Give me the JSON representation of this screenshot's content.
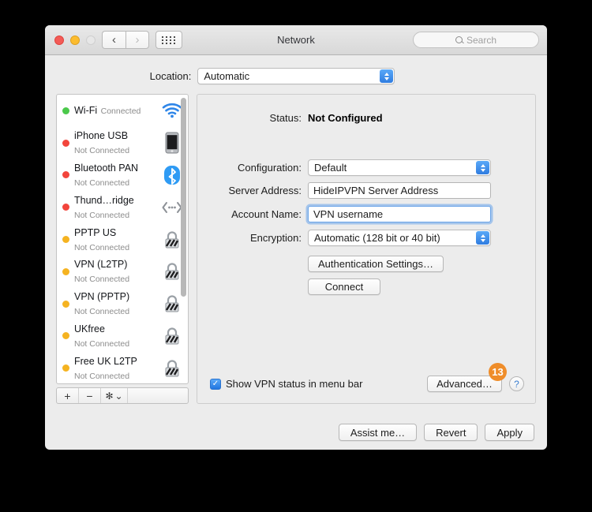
{
  "window": {
    "title": "Network",
    "search_placeholder": "Search",
    "traffic_lights": [
      "close",
      "minimize",
      "zoom"
    ],
    "nav_back_icon": "chevron-left-icon",
    "nav_forward_icon": "chevron-right-icon",
    "grid_icon": "show-all-icon",
    "search_icon": "search-icon"
  },
  "location": {
    "label": "Location:",
    "value": "Automatic"
  },
  "sidebar": {
    "services": [
      {
        "name": "Wi-Fi",
        "state": "Connected",
        "dot": "green",
        "icon": "wifi-icon"
      },
      {
        "name": "iPhone USB",
        "state": "Not Connected",
        "dot": "red",
        "icon": "iphone-icon"
      },
      {
        "name": "Bluetooth PAN",
        "state": "Not Connected",
        "dot": "red",
        "icon": "bluetooth-icon"
      },
      {
        "name": "Thund…ridge",
        "state": "Not Connected",
        "dot": "red",
        "icon": "thunderbolt-bridge-icon"
      },
      {
        "name": "PPTP US",
        "state": "Not Connected",
        "dot": "amber",
        "icon": "vpn-lock-icon"
      },
      {
        "name": "VPN (L2TP)",
        "state": "Not Connected",
        "dot": "amber",
        "icon": "vpn-lock-icon"
      },
      {
        "name": "VPN (PPTP)",
        "state": "Not Connected",
        "dot": "amber",
        "icon": "vpn-lock-icon"
      },
      {
        "name": "UKfree",
        "state": "Not Connected",
        "dot": "amber",
        "icon": "vpn-lock-icon"
      },
      {
        "name": "Free UK L2TP",
        "state": "Not Connected",
        "dot": "amber",
        "icon": "vpn-lock-icon"
      }
    ],
    "toolbar": {
      "add": "+",
      "remove": "−",
      "gear": "✻",
      "gear_chevron": "⌄"
    }
  },
  "main": {
    "status_label": "Status:",
    "status_value": "Not Configured",
    "configuration_label": "Configuration:",
    "configuration_value": "Default",
    "server_address_label": "Server Address:",
    "server_address_value": "HideIPVPN Server Address",
    "account_name_label": "Account Name:",
    "account_name_value": "VPN username",
    "encryption_label": "Encryption:",
    "encryption_value": "Automatic (128 bit or 40 bit)",
    "auth_settings_label": "Authentication Settings…",
    "connect_label": "Connect",
    "show_status_label": "Show VPN status in menu bar",
    "show_status_checked": "✓",
    "advanced_label": "Advanced…",
    "help_label": "?",
    "badge_number": "13"
  },
  "footer": {
    "assist_label": "Assist me…",
    "revert_label": "Revert",
    "apply_label": "Apply"
  },
  "colors": {
    "badge_orange": "#ef8d2a",
    "accent_blue": "#2f7ce0",
    "dot_green": "#4bc94b",
    "dot_red": "#f2453c",
    "dot_amber": "#f5b321"
  }
}
